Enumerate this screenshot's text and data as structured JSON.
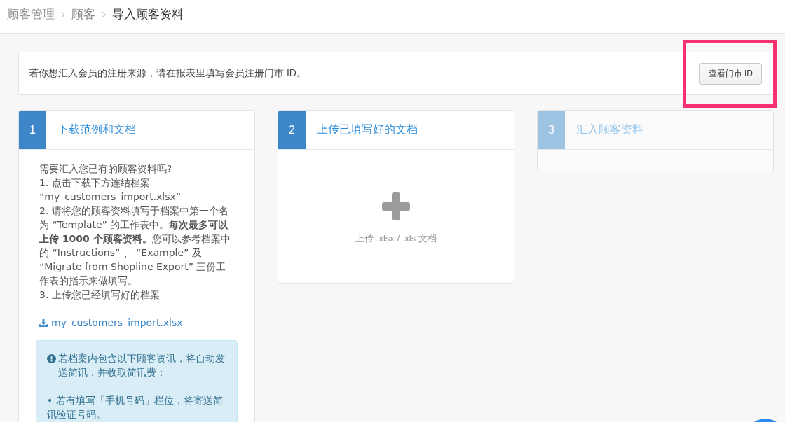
{
  "breadcrumb": [
    {
      "label": "顾客管理",
      "current": false
    },
    {
      "label": "顾客",
      "current": false
    },
    {
      "label": "导入顾客资料",
      "current": true
    }
  ],
  "notice": {
    "text": "若你想汇入会员的注册来源，请在报表里填写会员注册门市 ID。",
    "button": "查看门市 ID",
    "highlighted": true
  },
  "steps": [
    {
      "kind": "download",
      "number": "1",
      "title": "下载范例和文档",
      "disabled": false,
      "instructions": [
        "需要汇入您已有的顾客资料吗?",
        "1. 点击下载下方连结档案 “my_customers_import.xlsx”",
        "2. 请将您的顾客资料填写于档案中第一个名为 “Template” 的工作表中。**每次最多可以上传 1000 个顾客资料。**您可以参考档案中的 “Instructions” 、 “Example” 及 “Migrate from Shopline Export” 三份工作表的指示来做填写。",
        "3. 上传您已经填写好的档案"
      ],
      "link": "my_customers_import.xlsx",
      "alert": [
        "若档案内包含以下顾客资讯，将自动发送简讯，并收取简讯费：",
        "• 若有填写「手机号码」栏位，将寄送简讯验证号码。"
      ]
    },
    {
      "kind": "upload",
      "number": "2",
      "title": "上传已填写好的文档",
      "disabled": false,
      "dropzone": "上传 .xlsx / .xls 文档"
    },
    {
      "kind": "import",
      "number": "3",
      "title": "汇入顾客资料",
      "disabled": true
    }
  ]
}
